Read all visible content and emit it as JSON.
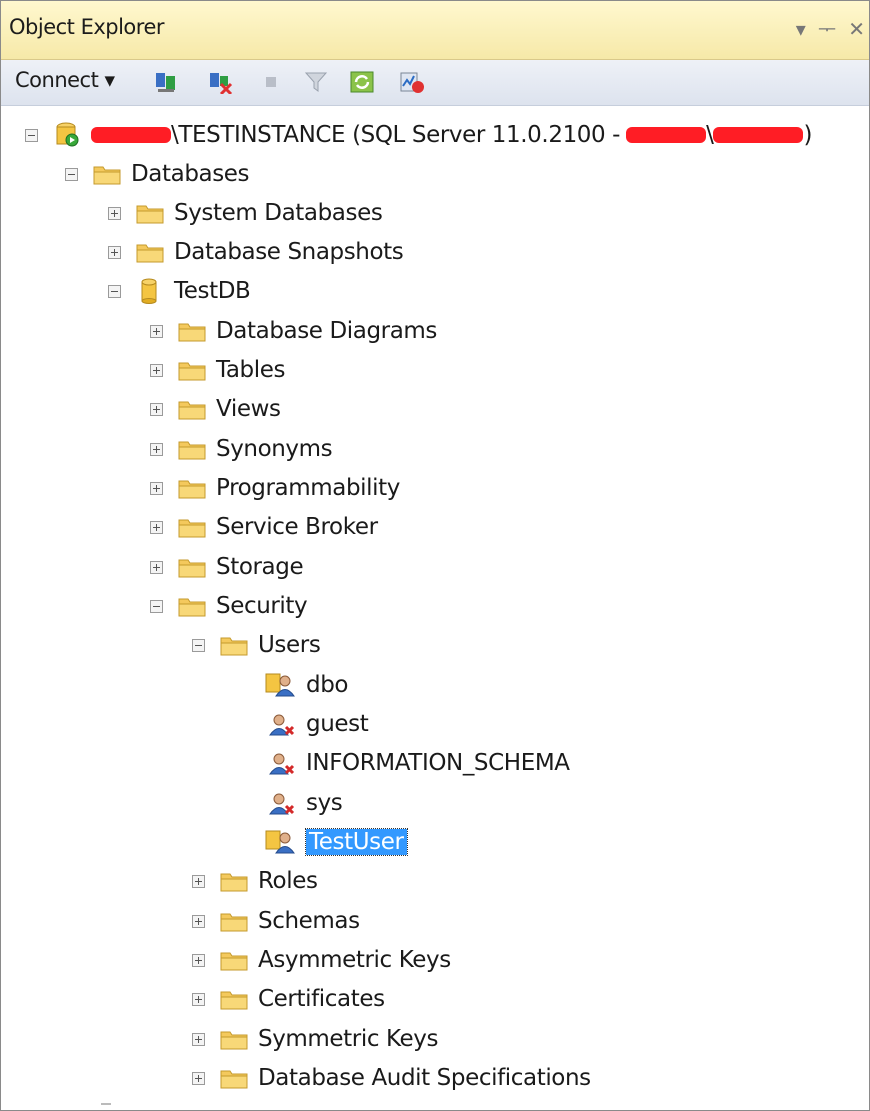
{
  "window": {
    "title": "Object Explorer"
  },
  "toolbar": {
    "connect_label": "Connect ▾"
  },
  "tree": {
    "server": {
      "label": "\\TESTINSTANCE (SQL Server 11.0.2100 -",
      "label_tail": "\\",
      "label_close": ")"
    },
    "databases": "Databases",
    "system_databases": "System Databases",
    "database_snapshots": "Database Snapshots",
    "testdb": "TestDB",
    "database_diagrams": "Database Diagrams",
    "tables": "Tables",
    "views": "Views",
    "synonyms": "Synonyms",
    "programmability": "Programmability",
    "service_broker": "Service Broker",
    "storage": "Storage",
    "security": "Security",
    "users": "Users",
    "user_dbo": "dbo",
    "user_guest": "guest",
    "user_information_schema": "INFORMATION_SCHEMA",
    "user_sys": "sys",
    "user_testuser": "TestUser",
    "roles": "Roles",
    "schemas": "Schemas",
    "asymmetric_keys": "Asymmetric Keys",
    "certificates": "Certificates",
    "symmetric_keys": "Symmetric Keys",
    "database_audit_specifications": "Database Audit Specifications"
  },
  "colors": {
    "selection": "#3399ff",
    "redaction": "#ff1d25",
    "folder": "#f4c95d",
    "title_bar": "#f6e9a8"
  }
}
